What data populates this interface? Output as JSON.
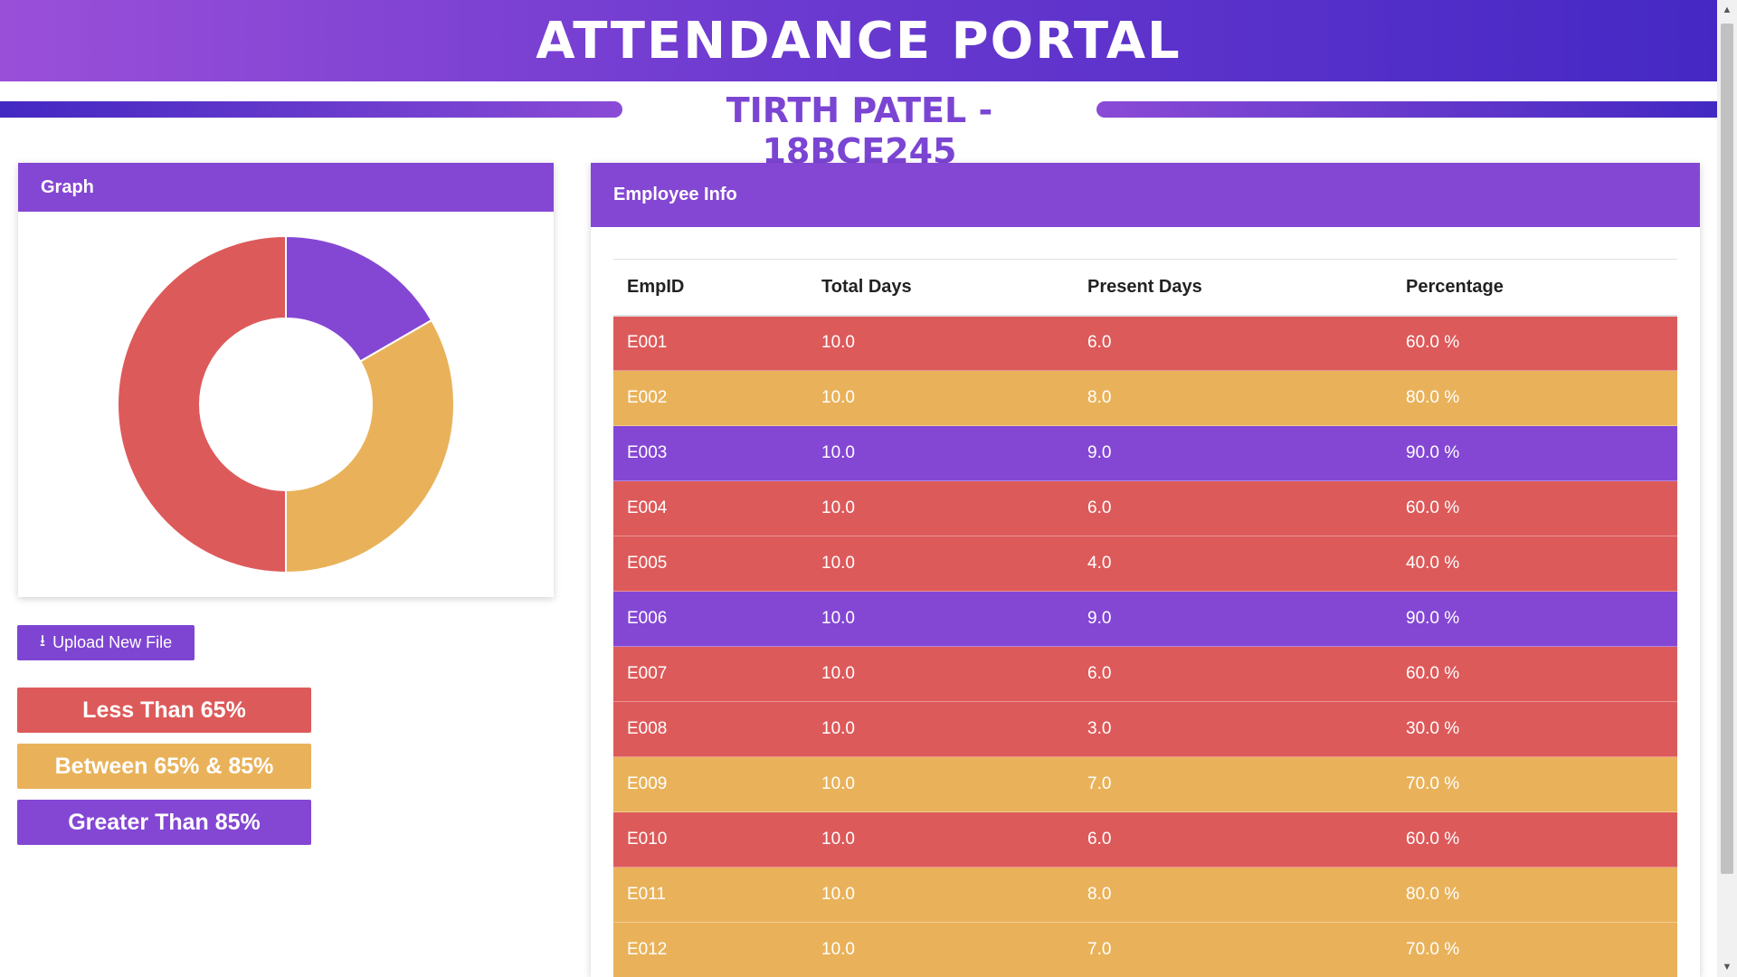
{
  "header": {
    "title": "ATTENDANCE PORTAL",
    "subtitle": "TIRTH PATEL - 18BCE245"
  },
  "graph": {
    "title": "Graph",
    "segments": [
      {
        "name": "Greater Than 85%",
        "count": 2,
        "color": "#8447d4"
      },
      {
        "name": "Between 65% & 85%",
        "count": 4,
        "color": "#e9b25a"
      },
      {
        "name": "Less Than 65%",
        "count": 6,
        "color": "#dd5a5a"
      }
    ]
  },
  "upload": {
    "label": "Upload New File",
    "icon": "download-icon"
  },
  "legend": [
    {
      "label": "Less Than 65%",
      "color": "#dd5a5a"
    },
    {
      "label": "Between 65% & 85%",
      "color": "#e9b25a"
    },
    {
      "label": "Greater Than 85%",
      "color": "#8447d4"
    }
  ],
  "employee": {
    "title": "Employee Info",
    "columns": [
      "EmpID",
      "Total Days",
      "Present Days",
      "Percentage"
    ],
    "rows": [
      {
        "id": "E001",
        "total": "10.0",
        "present": "6.0",
        "pct": "60.0 %",
        "color": "#dd5a5a"
      },
      {
        "id": "E002",
        "total": "10.0",
        "present": "8.0",
        "pct": "80.0 %",
        "color": "#e9b25a"
      },
      {
        "id": "E003",
        "total": "10.0",
        "present": "9.0",
        "pct": "90.0 %",
        "color": "#8447d4"
      },
      {
        "id": "E004",
        "total": "10.0",
        "present": "6.0",
        "pct": "60.0 %",
        "color": "#dd5a5a"
      },
      {
        "id": "E005",
        "total": "10.0",
        "present": "4.0",
        "pct": "40.0 %",
        "color": "#dd5a5a"
      },
      {
        "id": "E006",
        "total": "10.0",
        "present": "9.0",
        "pct": "90.0 %",
        "color": "#8447d4"
      },
      {
        "id": "E007",
        "total": "10.0",
        "present": "6.0",
        "pct": "60.0 %",
        "color": "#dd5a5a"
      },
      {
        "id": "E008",
        "total": "10.0",
        "present": "3.0",
        "pct": "30.0 %",
        "color": "#dd5a5a"
      },
      {
        "id": "E009",
        "total": "10.0",
        "present": "7.0",
        "pct": "70.0 %",
        "color": "#e9b25a"
      },
      {
        "id": "E010",
        "total": "10.0",
        "present": "6.0",
        "pct": "60.0 %",
        "color": "#dd5a5a"
      },
      {
        "id": "E011",
        "total": "10.0",
        "present": "8.0",
        "pct": "80.0 %",
        "color": "#e9b25a"
      },
      {
        "id": "E012",
        "total": "10.0",
        "present": "7.0",
        "pct": "70.0 %",
        "color": "#e9b25a"
      }
    ]
  }
}
